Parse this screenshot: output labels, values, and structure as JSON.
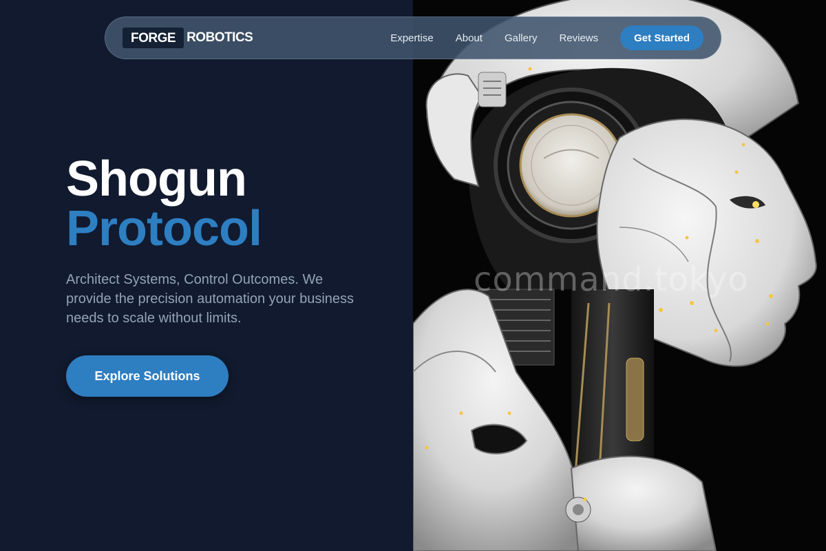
{
  "brand": {
    "mark": "FORGE",
    "word": "ROBOTICS"
  },
  "nav": {
    "links": [
      "Expertise",
      "About",
      "Gallery",
      "Reviews"
    ],
    "cta": "Get Started"
  },
  "hero": {
    "title_line1": "Shogun",
    "title_line2": "Protocol",
    "description": "Architect Systems, Control Outcomes. We provide the precision automation your business needs to scale without limits.",
    "button": "Explore Solutions"
  },
  "image": {
    "subject": "white humanoid robot head in profile",
    "watermark": "command.tokyo"
  },
  "colors": {
    "background": "#111a2e",
    "accent": "#2e7ec2",
    "muted_text": "#94a3b8"
  }
}
